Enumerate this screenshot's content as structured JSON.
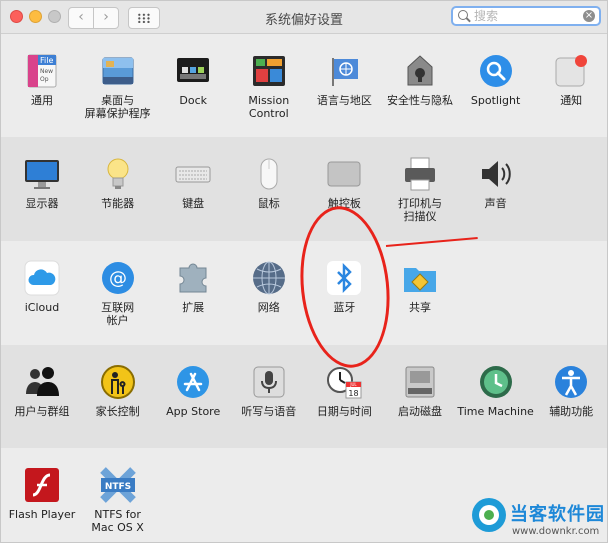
{
  "window": {
    "title": "系统偏好设置",
    "search": {
      "placeholder": "搜索",
      "value": ""
    }
  },
  "toolbar": {
    "back": "‹",
    "forward": "›",
    "clear": "×"
  },
  "rows": [
    [
      {
        "label": "通用",
        "icon": "general-icon"
      },
      {
        "label": "桌面与\n屏幕保护程序",
        "icon": "desktop-screensaver-icon"
      },
      {
        "label": "Dock",
        "icon": "dock-icon"
      },
      {
        "label": "Mission\nControl",
        "icon": "mission-control-icon"
      },
      {
        "label": "语言与地区",
        "icon": "language-region-icon"
      },
      {
        "label": "安全性与隐私",
        "icon": "security-privacy-icon"
      },
      {
        "label": "Spotlight",
        "icon": "spotlight-icon"
      },
      {
        "label": "通知",
        "icon": "notifications-icon"
      }
    ],
    [
      {
        "label": "显示器",
        "icon": "displays-icon"
      },
      {
        "label": "节能器",
        "icon": "energy-saver-icon"
      },
      {
        "label": "键盘",
        "icon": "keyboard-icon"
      },
      {
        "label": "鼠标",
        "icon": "mouse-icon"
      },
      {
        "label": "触控板",
        "icon": "trackpad-icon"
      },
      {
        "label": "打印机与\n扫描仪",
        "icon": "printers-scanners-icon"
      },
      {
        "label": "声音",
        "icon": "sound-icon"
      }
    ],
    [
      {
        "label": "iCloud",
        "icon": "icloud-icon"
      },
      {
        "label": "互联网\n帐户",
        "icon": "internet-accounts-icon"
      },
      {
        "label": "扩展",
        "icon": "extensions-icon"
      },
      {
        "label": "网络",
        "icon": "network-icon"
      },
      {
        "label": "蓝牙",
        "icon": "bluetooth-icon"
      },
      {
        "label": "共享",
        "icon": "sharing-icon"
      }
    ],
    [
      {
        "label": "用户与群组",
        "icon": "users-groups-icon"
      },
      {
        "label": "家长控制",
        "icon": "parental-controls-icon"
      },
      {
        "label": "App Store",
        "icon": "app-store-icon"
      },
      {
        "label": "听写与语音",
        "icon": "dictation-speech-icon"
      },
      {
        "label": "日期与时间",
        "icon": "date-time-icon"
      },
      {
        "label": "启动磁盘",
        "icon": "startup-disk-icon"
      },
      {
        "label": "Time Machine",
        "icon": "time-machine-icon"
      },
      {
        "label": "辅助功能",
        "icon": "accessibility-icon"
      }
    ],
    [
      {
        "label": "Flash Player",
        "icon": "flash-player-icon"
      },
      {
        "label": "NTFS for\nMac OS X",
        "icon": "ntfs-icon"
      }
    ]
  ],
  "icon_text": {
    "general": "File\nNew\nOp",
    "date_day": "18",
    "date_month": "JUL",
    "ntfs": "NTFS"
  },
  "watermark": {
    "text": "当客软件园",
    "url": "www.downkr.com"
  },
  "colors": {
    "annotation": "#e8231b",
    "search_focus": "#7fb0ef",
    "brand_blue": "#1e88d8"
  }
}
